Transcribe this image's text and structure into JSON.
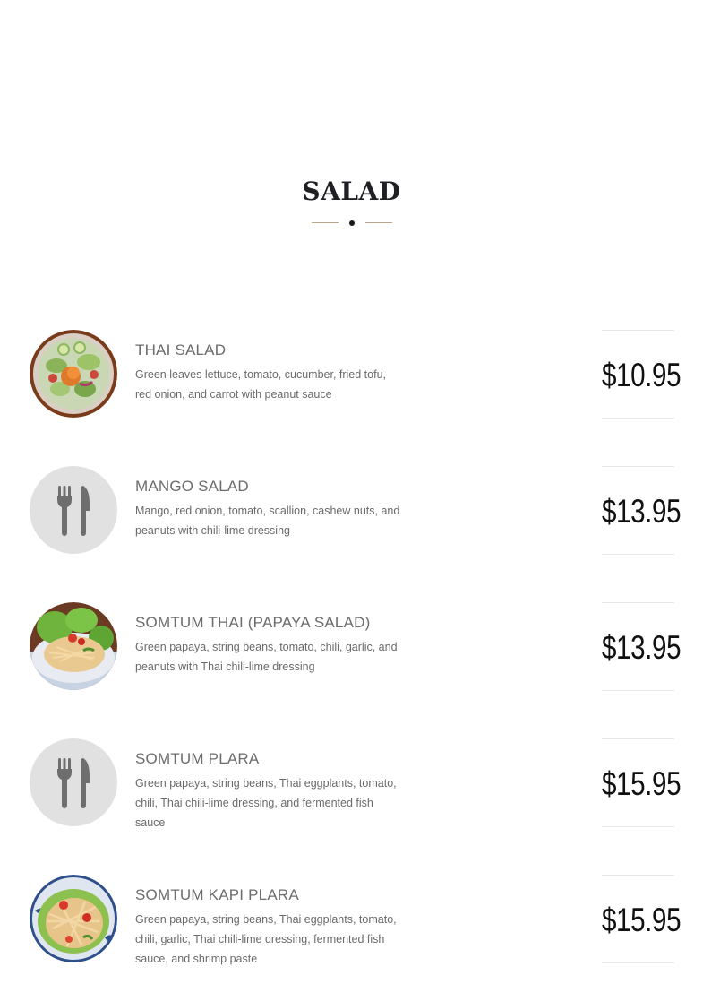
{
  "section": {
    "title": "SALAD"
  },
  "items": [
    {
      "name": "THAI SALAD",
      "description": "Green leaves lettuce, tomato, cucumber, fried tofu, red onion, and carrot with peanut sauce",
      "price": "$10.95",
      "image": "thai-salad-photo"
    },
    {
      "name": "MANGO SALAD",
      "description": "Mango, red onion, tomato, scallion, cashew nuts, and peanuts with chili-lime dressing",
      "price": "$13.95",
      "image": "fork-knife-icon"
    },
    {
      "name": "SOMTUM THAI (PAPAYA SALAD)",
      "description": "Green papaya, string beans, tomato, chili, garlic, and peanuts with Thai chili-lime dressing",
      "price": "$13.95",
      "image": "papaya-salad-photo"
    },
    {
      "name": "SOMTUM PLARA",
      "description": "Green papaya, string beans, Thai eggplants, tomato, chili, Thai chili-lime dressing, and fermented fish sauce",
      "price": "$15.95",
      "image": "fork-knife-icon"
    },
    {
      "name": "SOMTUM KAPI PLARA",
      "description": "Green papaya, string beans, Thai eggplants, tomato, chili, garlic, Thai chili-lime dressing, fermented fish sauce, and shrimp paste",
      "price": "$15.95",
      "image": "somtum-kapi-photo"
    }
  ],
  "colors": {
    "divider_accent": "#b8a58c",
    "placeholder_bg": "#e1e1e1",
    "icon_gray": "#6e6e6e"
  }
}
